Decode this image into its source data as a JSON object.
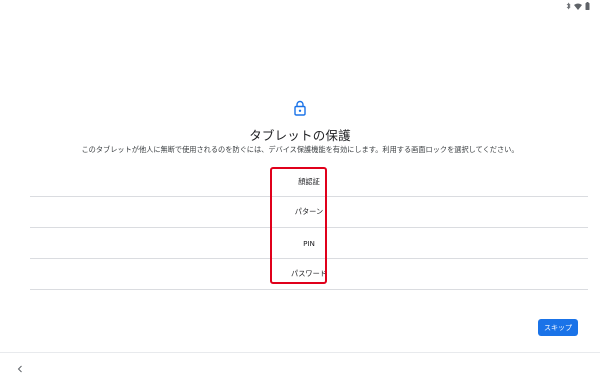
{
  "header": {
    "title": "タブレットの保護",
    "description": "このタブレットが他人に無断で使用されるのを防ぐには、デバイス保護機能を有効にします。利用する画面ロックを選択してください。"
  },
  "options": [
    {
      "label": "顔認証"
    },
    {
      "label": "パターン"
    },
    {
      "label": "PIN"
    },
    {
      "label": "パスワード"
    }
  ],
  "footer": {
    "skip_label": "スキップ"
  },
  "icons": {
    "header": "lock-icon",
    "status": [
      "bluetooth-icon",
      "wifi-icon",
      "battery-icon"
    ],
    "nav": "back-icon"
  },
  "colors": {
    "accent": "#1a73e8",
    "highlight": "#e0001b",
    "divider": "#dadce0"
  }
}
